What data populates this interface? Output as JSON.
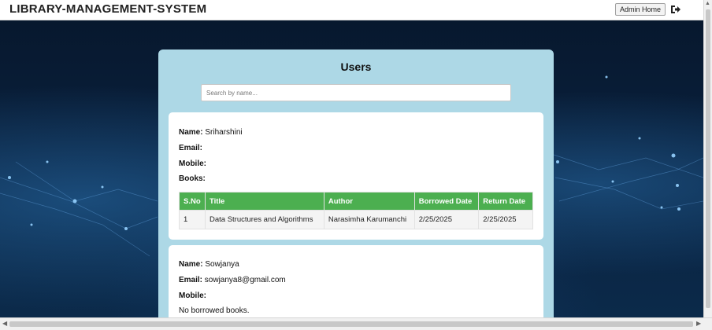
{
  "header": {
    "brand": "LIBRARY-MANAGEMENT-SYSTEM",
    "admin_home_label": "Admin Home",
    "logout_icon": "sign-out-icon"
  },
  "panel": {
    "title": "Users",
    "search_placeholder": "Search by name..."
  },
  "labels": {
    "name": "Name:",
    "email": "Email:",
    "mobile": "Mobile:",
    "books": "Books:"
  },
  "users": [
    {
      "name": "Sriharshini",
      "email": "",
      "mobile": "",
      "table_headers": [
        "S.No",
        "Title",
        "Author",
        "Borrowed Date",
        "Return Date"
      ],
      "books": [
        {
          "sno": "1",
          "title": "Data Structures and Algorithms",
          "author": "Narasimha Karumanchi",
          "borrowed": "2/25/2025",
          "return": "2/25/2025"
        }
      ]
    },
    {
      "name": "Sowjanya",
      "email": "sowjanya8@gmail.com",
      "mobile": "",
      "no_books_text": "No borrowed books."
    }
  ],
  "colors": {
    "panel": "#add8e6",
    "table_header": "#4caf50",
    "background": "#0a2240"
  }
}
